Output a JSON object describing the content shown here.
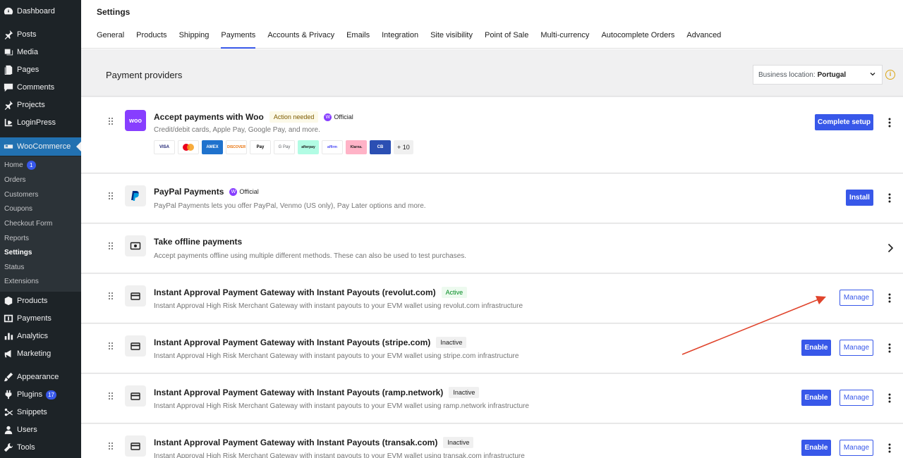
{
  "sidebar": {
    "items": [
      {
        "label": "Dashboard",
        "icon": "dashboard-icon"
      },
      {
        "label": "Posts",
        "icon": "pin-icon"
      },
      {
        "label": "Media",
        "icon": "media-icon"
      },
      {
        "label": "Pages",
        "icon": "pages-icon"
      },
      {
        "label": "Comments",
        "icon": "comments-icon"
      },
      {
        "label": "Projects",
        "icon": "pin-icon"
      },
      {
        "label": "LoginPress",
        "icon": "login-icon"
      },
      {
        "label": "WooCommerce",
        "icon": "woo-icon"
      },
      {
        "label": "Products",
        "icon": "products-icon"
      },
      {
        "label": "Payments",
        "icon": "payments-icon"
      },
      {
        "label": "Analytics",
        "icon": "analytics-icon"
      },
      {
        "label": "Marketing",
        "icon": "marketing-icon"
      },
      {
        "label": "Appearance",
        "icon": "appearance-icon"
      },
      {
        "label": "Plugins",
        "icon": "plugins-icon",
        "count": "17"
      },
      {
        "label": "Snippets",
        "icon": "snippets-icon"
      },
      {
        "label": "Users",
        "icon": "users-icon"
      },
      {
        "label": "Tools",
        "icon": "tools-icon"
      }
    ],
    "woo_submenu": [
      {
        "label": "Home",
        "count": "1"
      },
      {
        "label": "Orders"
      },
      {
        "label": "Customers"
      },
      {
        "label": "Coupons"
      },
      {
        "label": "Checkout Form"
      },
      {
        "label": "Reports"
      },
      {
        "label": "Settings",
        "current": true
      },
      {
        "label": "Status"
      },
      {
        "label": "Extensions"
      }
    ]
  },
  "header": {
    "title": "Settings",
    "tabs": [
      "General",
      "Products",
      "Shipping",
      "Payments",
      "Accounts & Privacy",
      "Emails",
      "Integration",
      "Site visibility",
      "Point of Sale",
      "Multi-currency",
      "Autocomplete Orders",
      "Advanced"
    ],
    "active_tab": "Payments"
  },
  "providers_section": {
    "title": "Payment providers",
    "location_label": "Business location:",
    "location_value": "Portugal"
  },
  "providers": [
    {
      "name": "Accept payments with Woo",
      "badge": "Action needed",
      "official": "Official",
      "description": "Credit/debit cards, Apple Pay, Google Pay, and more.",
      "payment_methods": [
        "VISA",
        "MC",
        "AMEX",
        "DISCOVER",
        "Pay",
        "G Pay",
        "afterpay",
        "affirm",
        "Klarna.",
        "CB"
      ],
      "more_methods": "+ 10",
      "action": "Complete setup"
    },
    {
      "name": "PayPal Payments",
      "official": "Official",
      "description": "PayPal Payments lets you offer PayPal, Venmo (US only), Pay Later options and more.",
      "action": "Install"
    },
    {
      "name": "Take offline payments",
      "description": "Accept payments offline using multiple different methods. These can also be used to test purchases."
    },
    {
      "name": "Instant Approval Payment Gateway with Instant Payouts (revolut.com)",
      "status": "Active",
      "description": "Instant Approval High Risk Merchant Gateway with instant payouts to your EVM wallet using revolut.com infrastructure",
      "manage": "Manage"
    },
    {
      "name": "Instant Approval Payment Gateway with Instant Payouts (stripe.com)",
      "status": "Inactive",
      "description": "Instant Approval High Risk Merchant Gateway with instant payouts to your EVM wallet using stripe.com infrastructure",
      "enable": "Enable",
      "manage": "Manage"
    },
    {
      "name": "Instant Approval Payment Gateway with Instant Payouts (ramp.network)",
      "status": "Inactive",
      "description": "Instant Approval High Risk Merchant Gateway with instant payouts to your EVM wallet using ramp.network infrastructure",
      "enable": "Enable",
      "manage": "Manage"
    },
    {
      "name": "Instant Approval Payment Gateway with Instant Payouts (transak.com)",
      "status": "Inactive",
      "description": "Instant Approval High Risk Merchant Gateway with instant payouts to your EVM wallet using transak.com infrastructure",
      "enable": "Enable",
      "manage": "Manage"
    }
  ],
  "colors": {
    "sidebar_bg": "#1d2327",
    "accent": "#3858e9",
    "woo_purple": "#873eff",
    "annotation_arrow": "#e0442c"
  }
}
